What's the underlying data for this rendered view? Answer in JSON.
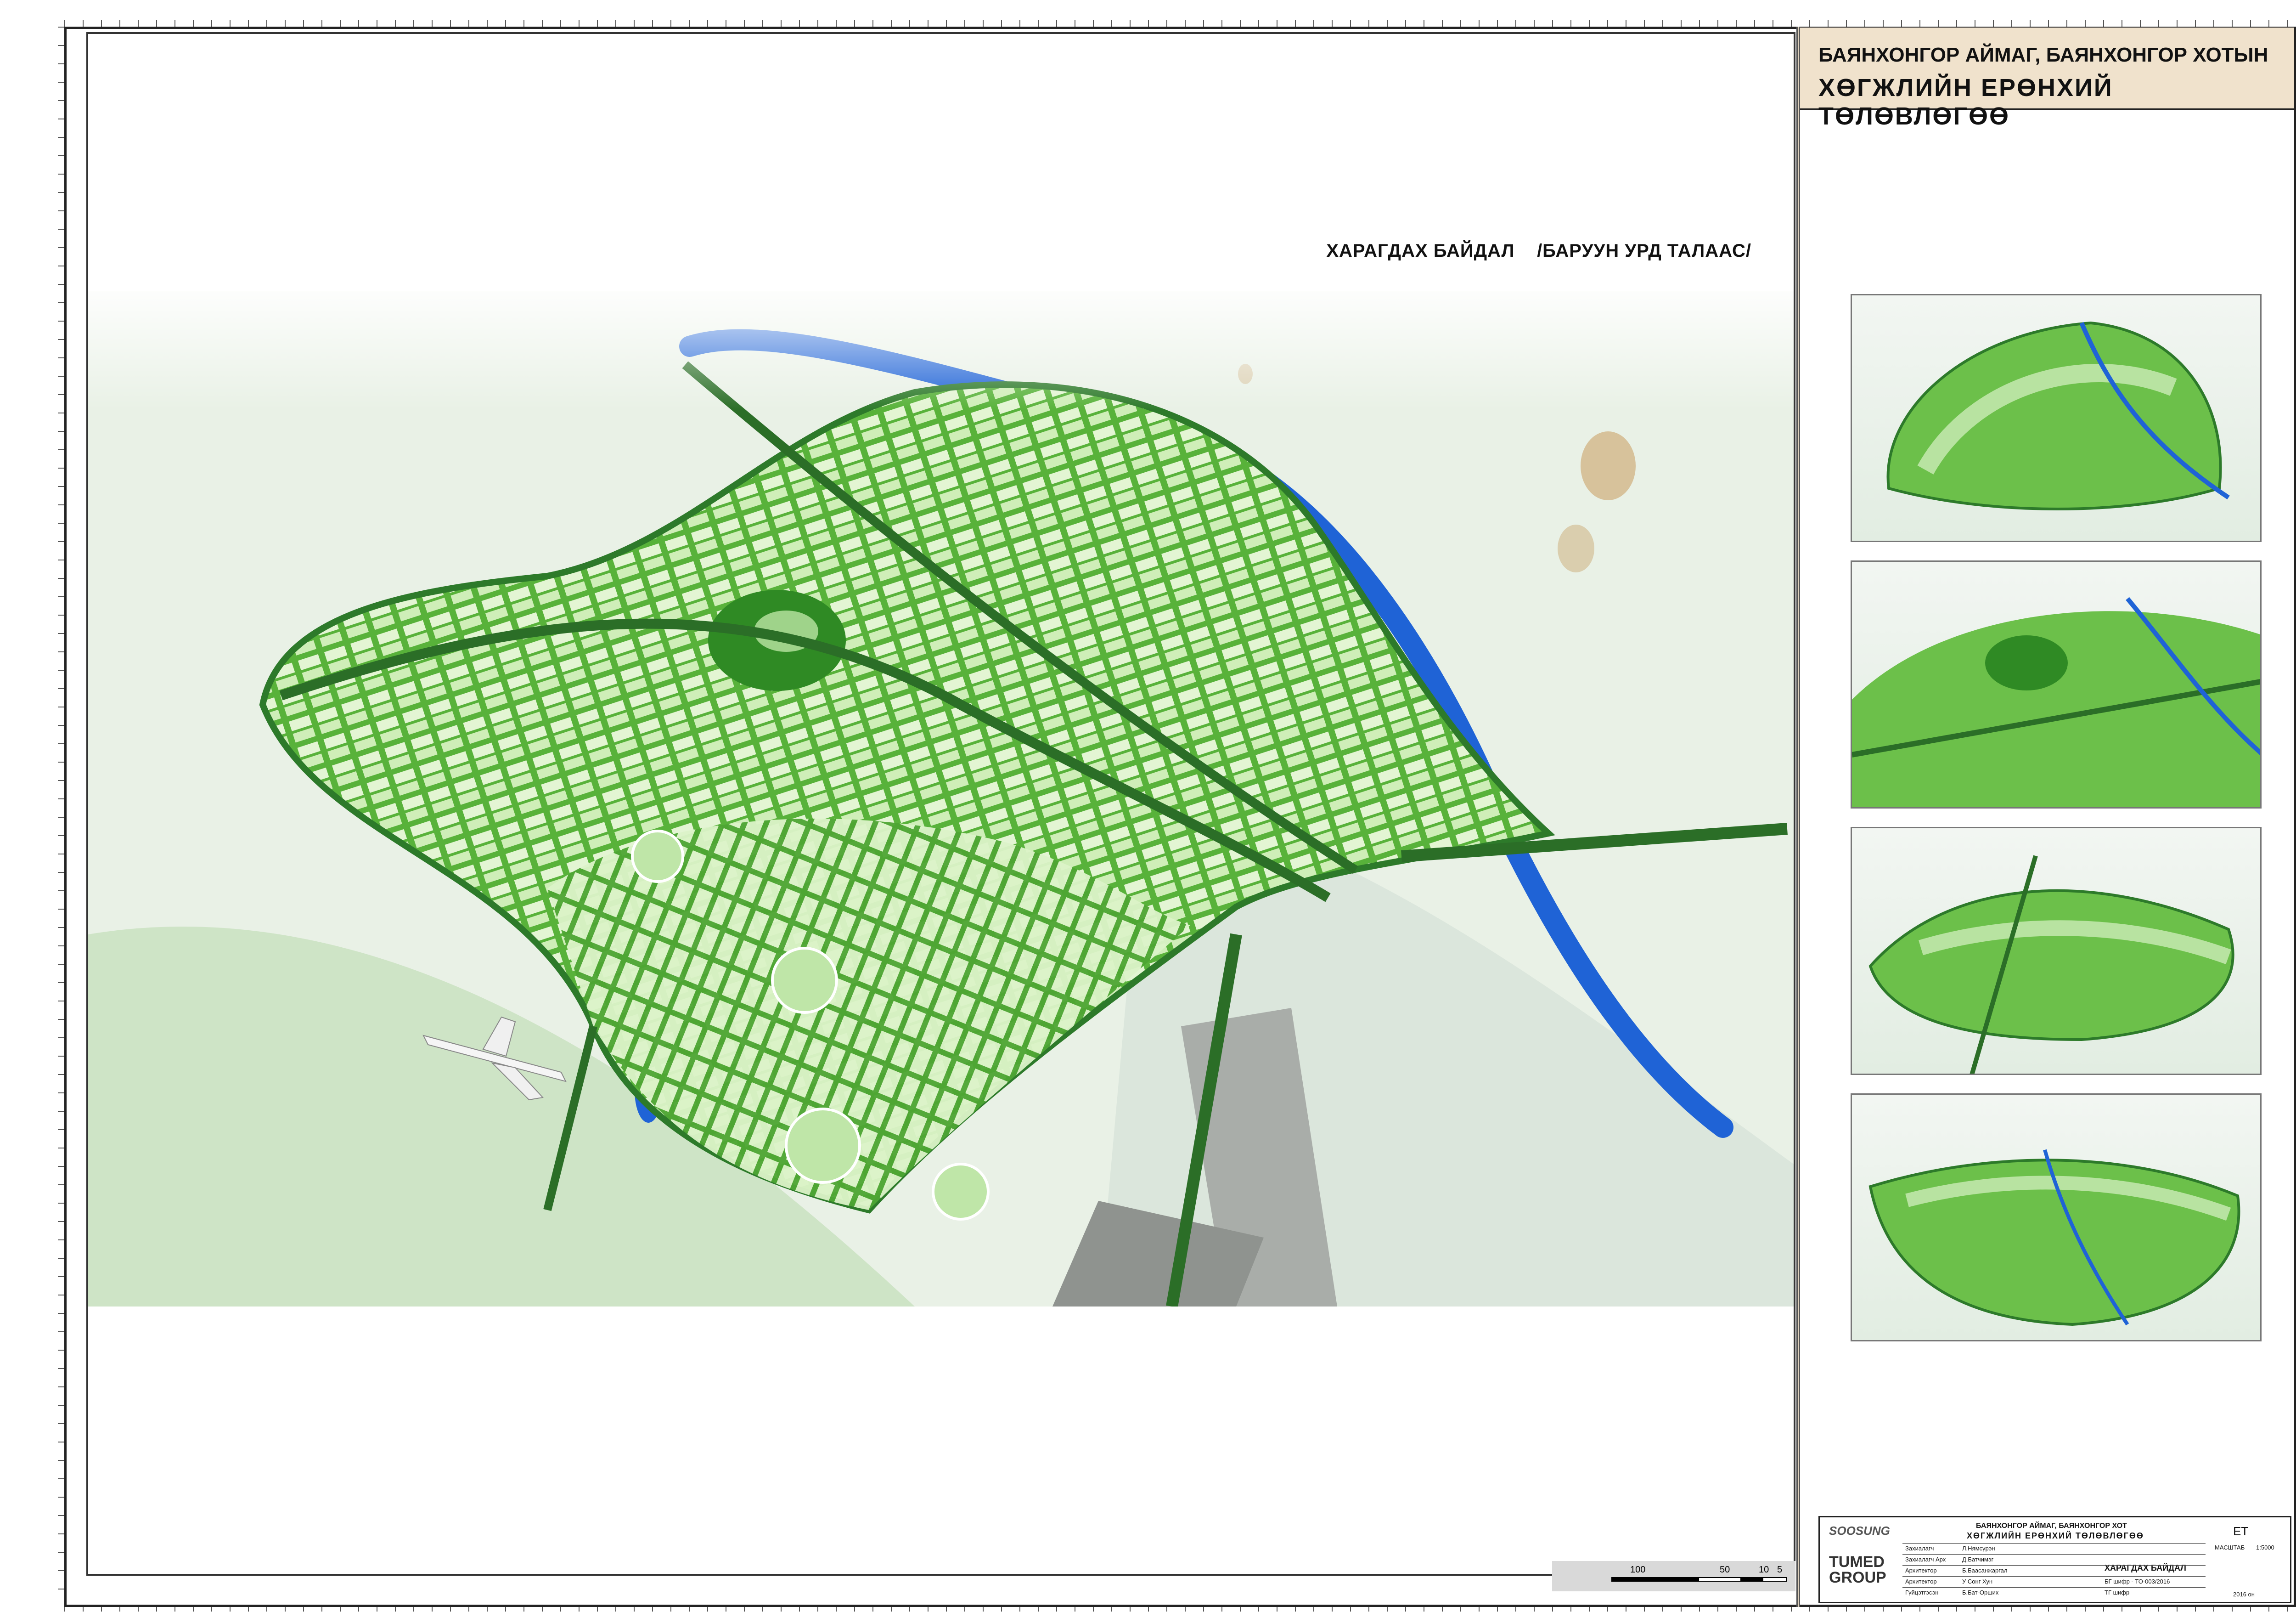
{
  "sheet": {
    "view_title": "ХАРАГДАХ БАЙДАЛ    /БАРУУН УРД ТАЛААС/"
  },
  "side_panel": {
    "title_line1": "БАЯНХОНГОР АЙМАГ, БАЯНХОНГОР ХОТЫН",
    "title_line2": "ХӨГЖЛИЙН ЕРӨНХИЙ ТӨЛӨВЛӨГӨӨ"
  },
  "scale_bar": {
    "labels": [
      "100",
      "50",
      "10",
      "5"
    ]
  },
  "title_block": {
    "brand_top": "SOOSUNG",
    "brand_bottom_1": "TUMED",
    "brand_bottom_2": "GROUP",
    "project_line1": "БАЯНХОНГОР АЙМАГ, БАЯНХОНГОР ХОТ",
    "project_line2": "ХӨГЖЛИЙН ЕРӨНХИЙ ТӨЛӨВЛӨГӨӨ",
    "sheet_code": "ET",
    "scale_label": "МАСШТАБ",
    "scale_value": "1:5000",
    "drawing_name": "ХАРАГДАХ БАЙДАЛ",
    "rows": [
      {
        "role": "Захиалагч",
        "name": "Л.Нямсүрэн"
      },
      {
        "role": "Захиалагч Арх",
        "name": "Д.Батчимэг"
      },
      {
        "role": "Архитектор",
        "name": "Б.Баасанжаргал"
      },
      {
        "role": "Архитектор",
        "name": "У Сонг Хун"
      },
      {
        "role": "Гүйцэтгэсэн",
        "name": "Б.Бат-Орших"
      }
    ],
    "code_1": "БГ шифр - ТО-003/2016",
    "code_2": "ТГ шифр",
    "year": "2016 он"
  },
  "colors": {
    "land_green": "#5fb83a",
    "block_light": "#d9f2c4",
    "water_blue": "#1f63d6",
    "header_beige": "#f0e2cc"
  }
}
